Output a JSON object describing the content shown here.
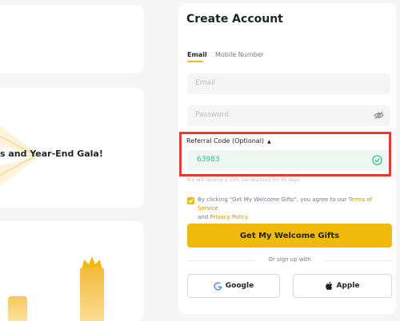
{
  "promo": {
    "gala_title": "s and Year-End Gala!"
  },
  "form": {
    "title": "Create Account",
    "tabs": [
      {
        "label": "Email",
        "active": true
      },
      {
        "label": "Mobile Number",
        "active": false
      }
    ],
    "email_placeholder": "Email",
    "password_placeholder": "Password",
    "referral": {
      "label": "Referral Code (Optional)",
      "caret": "▲",
      "value": "63983",
      "note": "You will receive a 20% fee discount for 45 days."
    },
    "agreement": {
      "prefix": "By clicking \"Get My Welcome Gifts\", you agree to our ",
      "tos": "Terms of Service",
      "and": " and ",
      "privacy": "Privacy Policy"
    },
    "submit_label": "Get My Welcome Gifts",
    "or_text": "Or sign up with",
    "google_label": "Google",
    "apple_label": "Apple"
  },
  "colors": {
    "accent": "#f0b90b",
    "success": "#2ebd85",
    "highlight": "#e33b2f"
  }
}
